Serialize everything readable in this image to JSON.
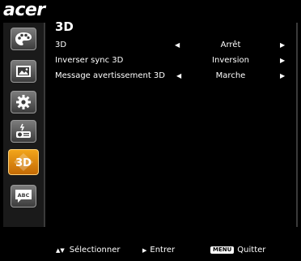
{
  "brand": "acer",
  "menu": {
    "title": "3D",
    "items": [
      {
        "label": "3D",
        "value": "Arrêt"
      },
      {
        "label": "Inverser sync 3D",
        "value": "Inversion"
      },
      {
        "label": "Message avertissement 3D",
        "value": "Marche"
      }
    ]
  },
  "sidebar": {
    "icons": [
      "palette-icon",
      "image-icon",
      "settings-icon",
      "projector-icon",
      "3d-icon",
      "language-icon"
    ],
    "active": "3d-icon",
    "icon_texts": {
      "3d": "3D",
      "language": "ABC"
    }
  },
  "footer": {
    "select_label": "Sélectionner",
    "enter_label": "Entrer",
    "menu_key": "MENU",
    "quit_label": "Quitter"
  },
  "colors": {
    "active_icon": "#e8901a",
    "background": "#000000",
    "panel": "#1a1a1a"
  }
}
